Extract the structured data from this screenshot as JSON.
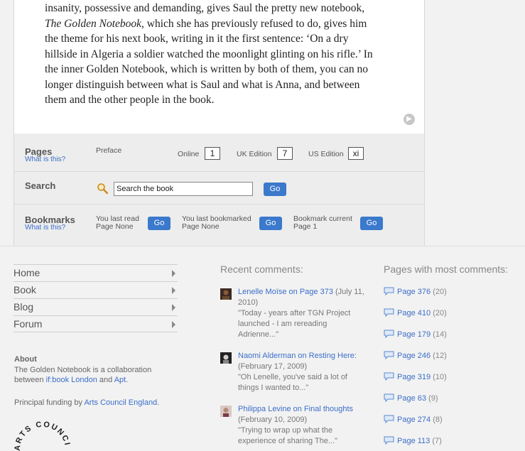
{
  "text": {
    "line1": "insanity, possessive and demanding, gives Saul the pretty new notebook,",
    "line2_italic": "The Golden Notebook",
    "line2_rest": ", which she has previously refused to do, gives him",
    "line3": "the theme for his next book, writing in it the first sentence: ‘On a dry",
    "line4": "hillside in Algeria a soldier watched the moonlight glinting on his rifle.’ In",
    "line5": "the inner Golden Notebook, which is written by both of them, you can no",
    "line6": "longer distinguish between what is Saul and what is Anna, and between",
    "line7": "them and the other people in the book."
  },
  "tools": {
    "pages": {
      "title": "Pages",
      "what": "What is this?",
      "preface": "Preface",
      "online_label": "Online",
      "online_value": "1",
      "uk_label": "UK Edition",
      "uk_value": "7",
      "us_label": "US Edition",
      "us_value": "xi"
    },
    "search": {
      "title": "Search",
      "value": "Search the book",
      "go": "Go"
    },
    "bookmarks": {
      "title": "Bookmarks",
      "what": "What is this?",
      "last_read_l1": "You last read",
      "last_read_l2": "Page None",
      "last_bookmarked_l1": "You last bookmarked",
      "last_bookmarked_l2": "Page None",
      "bookmark_current_l1": "Bookmark current",
      "bookmark_current_l2": "Page 1",
      "go": "Go"
    }
  },
  "nav": [
    "Home",
    "Book",
    "Blog",
    "Forum"
  ],
  "about": {
    "title": "About",
    "line1": "The Golden Notebook is a collaboration",
    "line2_pre": "between ",
    "line2_link1": "if:book London",
    "line2_mid": " and ",
    "line2_link2": "Apt",
    "line2_end": ".",
    "funding_pre": "Principal funding by ",
    "funding_link": "Arts Council England",
    "funding_end": ".",
    "logo_text": "ARTS COUNCIL"
  },
  "recent": {
    "title": "Recent comments:",
    "items": [
      {
        "link": "Lenelle Moïse on Page 373",
        "date_a": " (July 11,",
        "date_b": "2010)",
        "q1": "\"Today - years after TGN Project",
        "q2": "launched - I am rereading",
        "q3": "Adrienne...\""
      },
      {
        "link": "Naomi Alderman on Resting Here:",
        "date_b": "(February 17, 2009)",
        "q1": "\"Oh Lenelle, you've said a lot of",
        "q2": "things I wanted to...\""
      },
      {
        "link": "Philippa Levine on Final thoughts",
        "date_b": "(February 10, 2009)",
        "q1": "\"Trying to wrap up what the",
        "q2": "experience of sharing The...\""
      }
    ]
  },
  "most": {
    "title": "Pages with most comments:",
    "items": [
      {
        "page": "Page 376",
        "count": " (20)"
      },
      {
        "page": "Page 410",
        "count": " (20)"
      },
      {
        "page": "Page 179",
        "count": " (14)"
      },
      {
        "page": "Page 246",
        "count": " (12)"
      },
      {
        "page": "Page 319",
        "count": " (10)"
      },
      {
        "page": "Page 63",
        "count": " (9)"
      },
      {
        "page": "Page 274",
        "count": " (8)"
      },
      {
        "page": "Page 113",
        "count": " (7)"
      }
    ]
  },
  "colors": {
    "link": "#3b6ec9",
    "button": "#3a79cc",
    "panel": "#ededed",
    "background": "#f2f2f2"
  },
  "icons": {
    "next": "chevron-right-icon",
    "search": "magnifier-icon",
    "comment": "speech-bubble-icon"
  }
}
